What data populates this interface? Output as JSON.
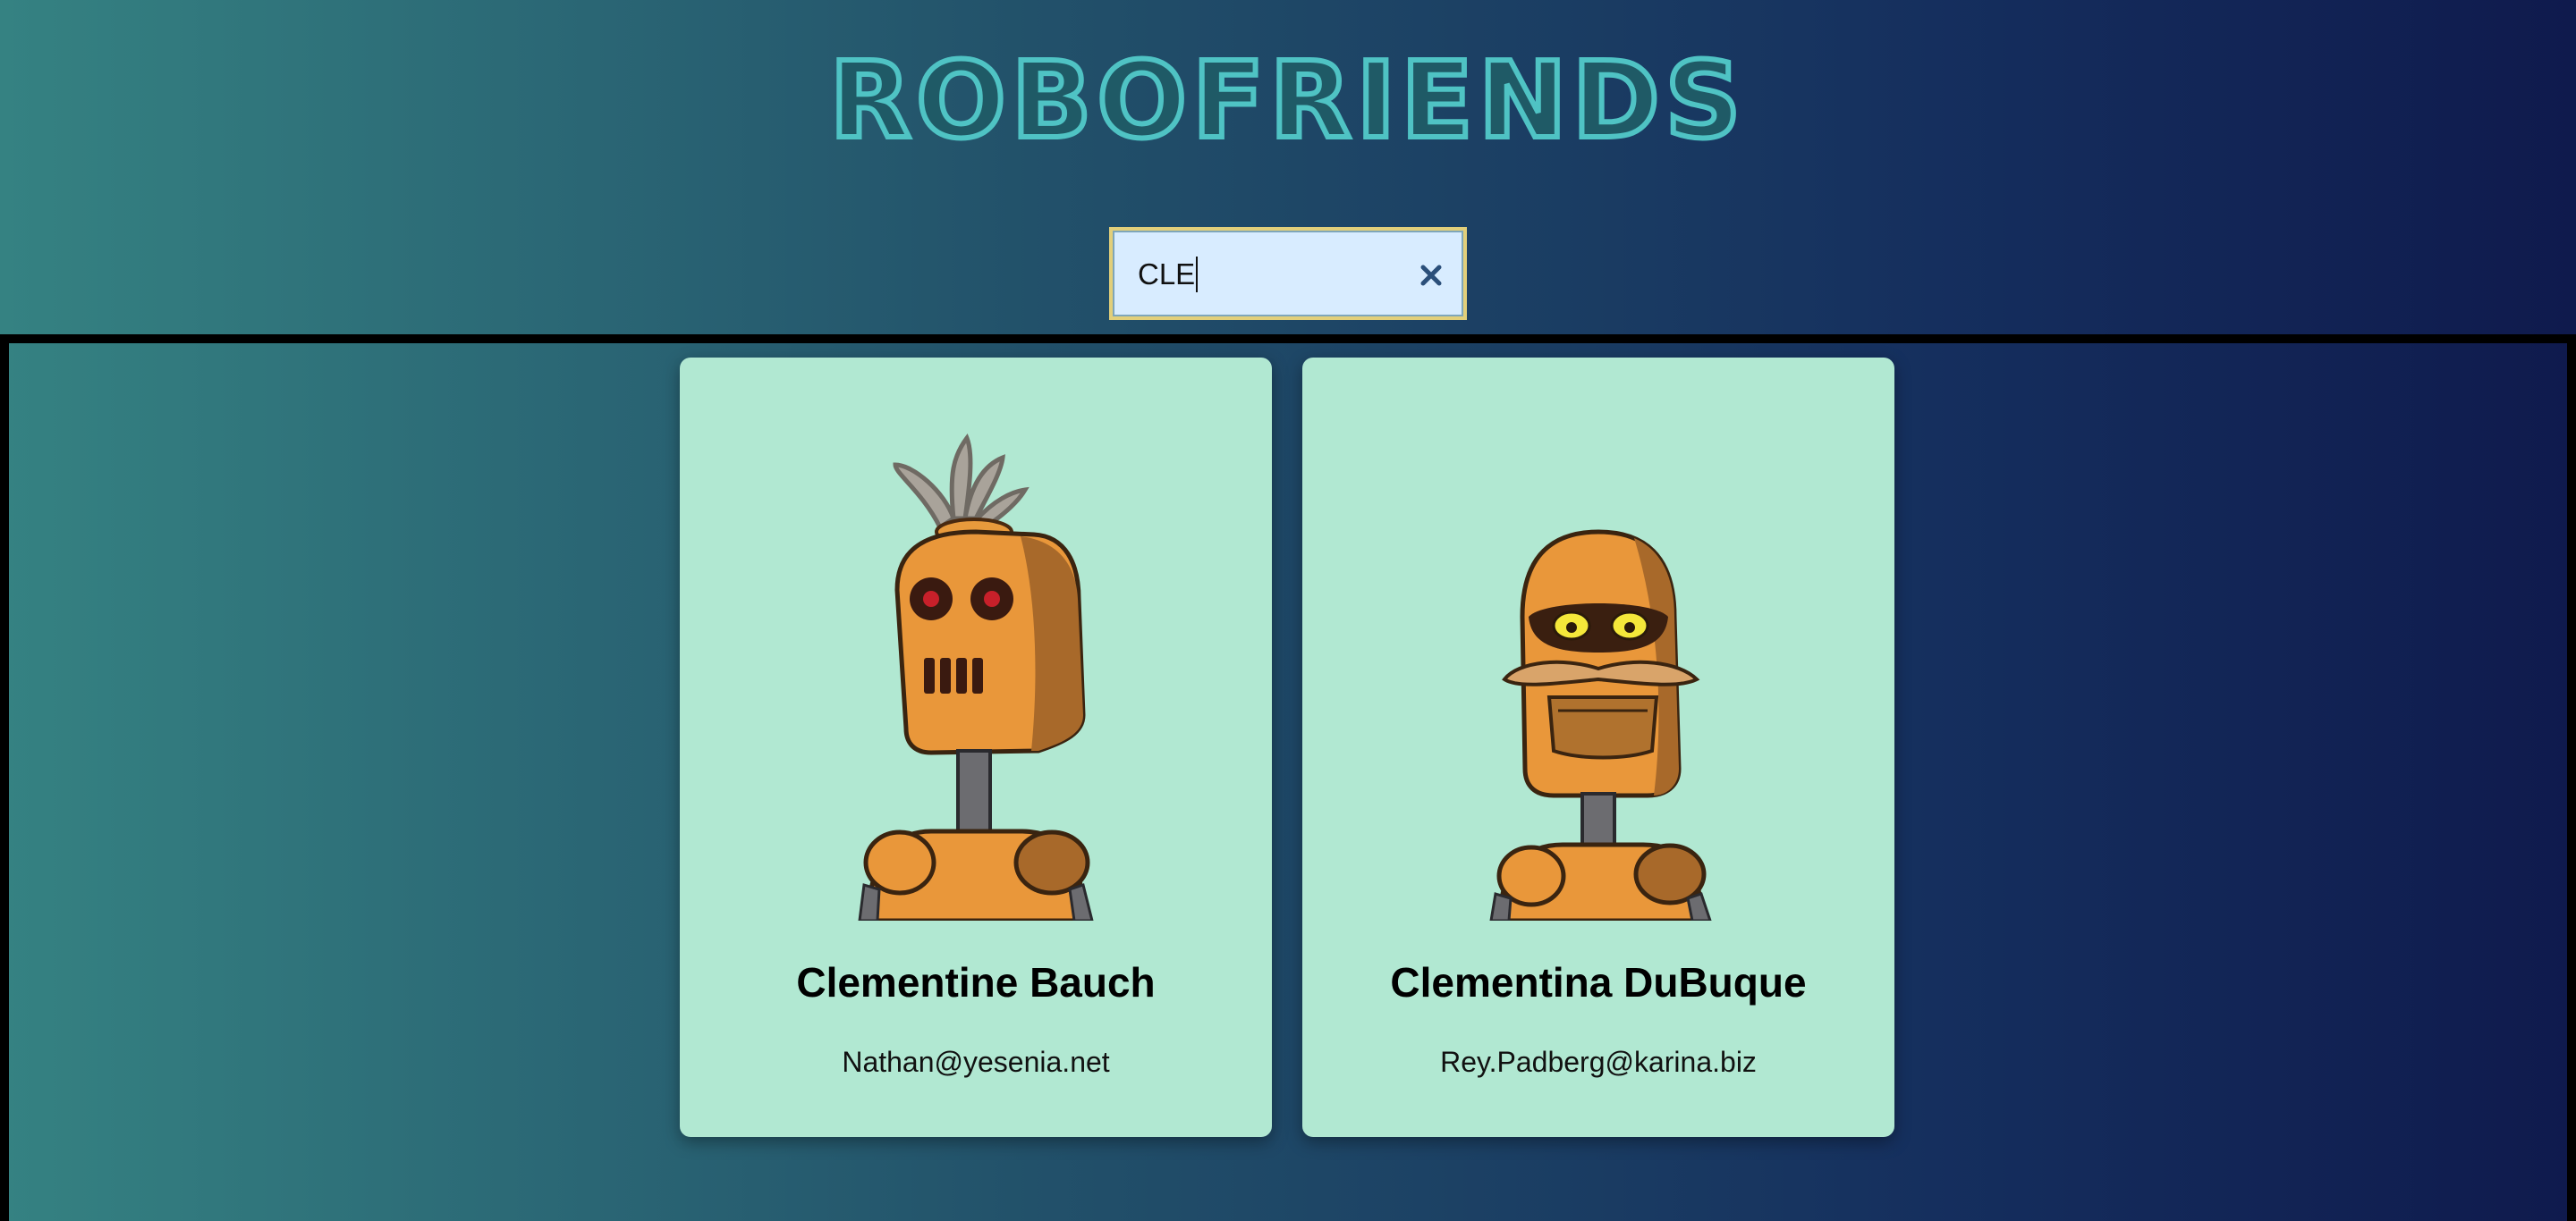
{
  "app": {
    "title": "ROBOFRIENDS"
  },
  "search": {
    "value": "CLE",
    "clear_icon": "close-icon"
  },
  "colors": {
    "logo": "#4fc3c4",
    "card_background": "#b1e8d2",
    "search_background": "#d8ecff",
    "search_border": "#e2cf7a"
  },
  "robots": [
    {
      "name": "Clementine Bauch",
      "email": "Nathan@yesenia.net",
      "avatar_icon": "robot-avatar-icon"
    },
    {
      "name": "Clementina DuBuque",
      "email": "Rey.Padberg@karina.biz",
      "avatar_icon": "robot-avatar-icon"
    }
  ]
}
